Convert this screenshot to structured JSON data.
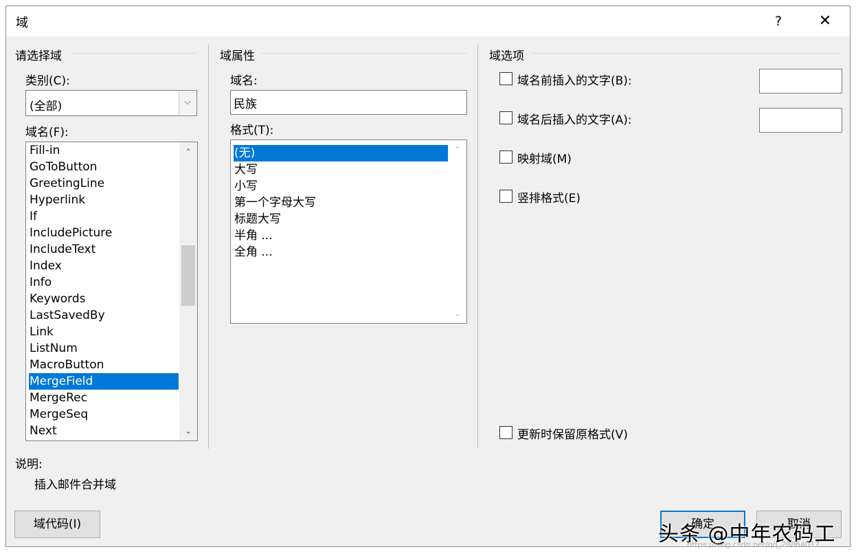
{
  "window": {
    "title": "域",
    "help_label": "?",
    "close_label": "✕"
  },
  "left": {
    "group_title": "请选择域",
    "category_label": "类别(C):",
    "category_value": "(全部)",
    "category_arrow": "⌵",
    "field_names_label": "域名(F):",
    "field_names": [
      "Fill-in",
      "GoToButton",
      "GreetingLine",
      "Hyperlink",
      "If",
      "IncludePicture",
      "IncludeText",
      "Index",
      "Info",
      "Keywords",
      "LastSavedBy",
      "Link",
      "ListNum",
      "MacroButton",
      "MergeField",
      "MergeRec",
      "MergeSeq",
      "Next"
    ],
    "selected_field": "MergeField",
    "scroll_up": "⌃",
    "scroll_down": "⌄"
  },
  "middle": {
    "group_title": "域属性",
    "field_name_label": "域名:",
    "field_name_value": "民族",
    "format_label": "格式(T):",
    "formats": [
      "(无)",
      "大写",
      "小写",
      "第一个字母大写",
      "标题大写",
      "半角 ...",
      "全角 ..."
    ],
    "selected_format": "(无)"
  },
  "right": {
    "group_title": "域选项",
    "options": [
      {
        "label": "域名前插入的文字(B):",
        "checked": false,
        "has_input": true,
        "input_value": ""
      },
      {
        "label": "域名后插入的文字(A):",
        "checked": false,
        "has_input": true,
        "input_value": ""
      },
      {
        "label": "映射域(M)",
        "checked": false,
        "has_input": false
      },
      {
        "label": "竖排格式(E)",
        "checked": false,
        "has_input": false
      }
    ],
    "preserve_format_label": "更新时保留原格式(V)",
    "preserve_format_checked": false
  },
  "description": {
    "label": "说明:",
    "text": "插入邮件合并域"
  },
  "buttons": {
    "field_codes": "域代码(I)",
    "ok": "确定",
    "cancel": "取消"
  },
  "watermark": {
    "text": "头条 @中年农码工",
    "url": "https://blog.csdn.net/qq_28864017"
  },
  "colors": {
    "selection": "#0078d7",
    "dialog_bg": "#f0f0f0"
  }
}
